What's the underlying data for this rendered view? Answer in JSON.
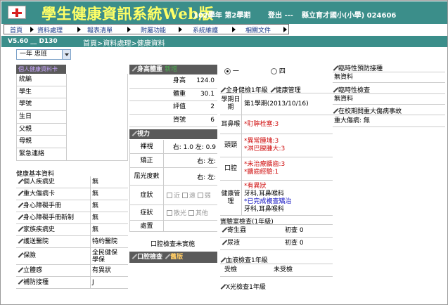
{
  "header": {
    "title": "學生健康資訊系統Web版",
    "year": "102學年 第2學期",
    "logout": "登出 ---",
    "school": "縣立育才國小(小學) 024606"
  },
  "menu": [
    "首頁",
    "資料處理",
    "報表清單",
    "附屬功能",
    "系統維護",
    "相關文件"
  ],
  "subbar": {
    "version": "V5.60 __ D130",
    "breadcrumb": "首頁>資料處理>健康資料"
  },
  "class_select": "一年 忠班",
  "basic": {
    "header": "個人健康資料卡",
    "fields": [
      "統編",
      "學生",
      "學號",
      "生日",
      "父親",
      "母親",
      "緊急連絡"
    ]
  },
  "health": {
    "title": "健康基本資料",
    "rows": [
      {
        "label": "個人疾病史",
        "value": "無"
      },
      {
        "label": "重大傷病卡",
        "value": "無"
      },
      {
        "label": "身心障礙手冊",
        "value": "無"
      },
      {
        "label": "身心障礙手冊新制",
        "value": "無"
      },
      {
        "label": "家族疾病史",
        "value": "無"
      },
      {
        "label": "護送醫院",
        "value": "特約醫院"
      },
      {
        "label": "保險",
        "value": "全民健保\n學保"
      },
      {
        "label": "立體感",
        "value": "有異狀"
      },
      {
        "label": "補防接種",
        "value": "J"
      }
    ]
  },
  "body": {
    "header": "身高體重",
    "header_extra": "新增",
    "rows": [
      {
        "label": "身高",
        "value": "124.0"
      },
      {
        "label": "體重",
        "value": "30.1"
      },
      {
        "label": "評值",
        "value": "2"
      },
      {
        "label": "資號",
        "value": "6"
      }
    ]
  },
  "vision": {
    "header": "視力",
    "rows": [
      {
        "label": "裸視",
        "value": "右: 1.0 左: 0.9"
      },
      {
        "label": "矯正",
        "value": "右: 左:"
      },
      {
        "label": "屈光度數",
        "value": "右: 左:"
      },
      {
        "label": "症狀",
        "opts": [
          "近",
          "遠",
          "弱"
        ]
      },
      {
        "label": "症狀",
        "opts": [
          "散光",
          "其他"
        ]
      },
      {
        "label": "處置",
        "value": ""
      }
    ],
    "oral_note": "口腔檢查未實施"
  },
  "oral_bar": {
    "text": "口腔檢查",
    "extra": "舊版"
  },
  "terms": [
    {
      "label": "一",
      "selected": true
    },
    {
      "label": "四",
      "selected": false
    }
  ],
  "exam": {
    "title": "全身健檢1年級",
    "title2": "健康管理",
    "rows": [
      {
        "label": "學期日期",
        "lines": [
          {
            "t": "第1學期(2013/10/16)",
            "c": ""
          }
        ]
      },
      {
        "label": "耳鼻喉",
        "lines": [
          {
            "t": "*耵聹栓塞:3",
            "c": "red"
          }
        ]
      },
      {
        "label": "頭頸",
        "lines": [
          {
            "t": "*異常腫塊:3",
            "c": "red"
          },
          {
            "t": "*淋巴腺腫大:3",
            "c": "red"
          }
        ]
      },
      {
        "label": "口腔",
        "lines": [
          {
            "t": "*未治療齲齒:3",
            "c": "red"
          },
          {
            "t": "*齲齒經驗:1",
            "c": "red"
          }
        ]
      },
      {
        "label": "健康管理",
        "lines": [
          {
            "t": "*有異狀",
            "c": "red"
          },
          {
            "t": "牙科,耳鼻喉科",
            "c": ""
          },
          {
            "t": "*已完成複查矯治",
            "c": "blue"
          },
          {
            "t": "牙科,耳鼻喉科",
            "c": ""
          }
        ]
      }
    ]
  },
  "lab": {
    "title": "實驗室檢查(1年級)",
    "rows": [
      {
        "label": "寄生蟲",
        "value": "初查 0"
      },
      {
        "label": "尿液",
        "value": "初查 0"
      }
    ]
  },
  "blood": {
    "title": "血液檢查1年級",
    "rows": [
      {
        "label": "受檢",
        "value": "未受檢"
      }
    ]
  },
  "xray": {
    "title": "X光檢查1年級"
  },
  "right": {
    "vaccine_title": "臨時性預防接種",
    "vaccine_value": "無資料",
    "check_title": "臨時性檢查",
    "check_value": "無資料",
    "injury_title": "在校期間重大傷病事故",
    "injury_value": "重大傷病: 無"
  }
}
